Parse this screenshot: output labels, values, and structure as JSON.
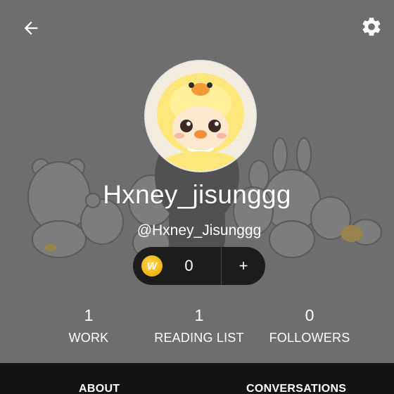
{
  "header": {
    "back_icon": "arrow-left-icon",
    "settings_icon": "gear-icon"
  },
  "profile": {
    "display_name": "Hxney_jisunggg",
    "username": "@Hxney_Jisunggg",
    "avatar": "duck-plush-avatar"
  },
  "coins": {
    "icon": "w-coin-icon",
    "icon_letter": "W",
    "count": "0",
    "add_label": "+"
  },
  "stats": [
    {
      "value": "1",
      "label": "WORK"
    },
    {
      "value": "1",
      "label": "READING LIST"
    },
    {
      "value": "0",
      "label": "FOLLOWERS"
    }
  ],
  "tabs": [
    {
      "label": "ABOUT"
    },
    {
      "label": "CONVERSATIONS"
    }
  ],
  "colors": {
    "header_bg": "#6e6e6e",
    "tabbar_bg": "#141414",
    "coin_gold": "#f5b918",
    "pill_bg": "#1c1c1c"
  }
}
